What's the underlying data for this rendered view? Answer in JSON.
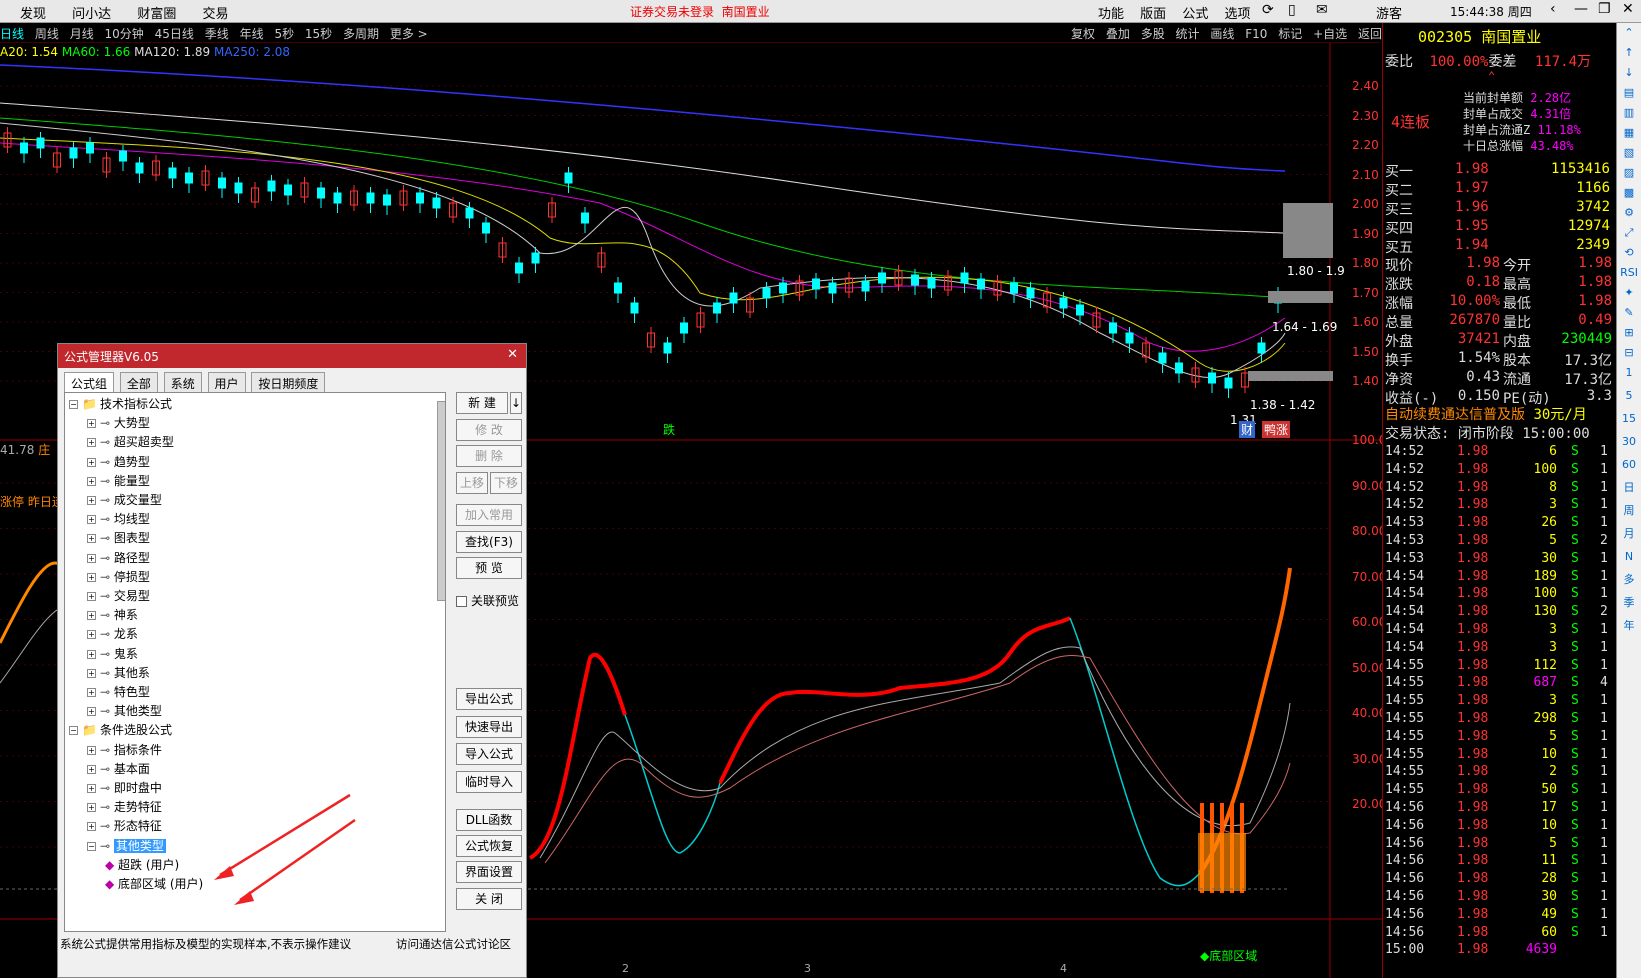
{
  "topbar": {
    "menu": [
      "发现",
      "问小达",
      "财富圈",
      "交易"
    ],
    "notice": "证券交易未登录",
    "stock_notice": "南国置业",
    "right_menu": [
      "功能",
      "版面",
      "公式",
      "选项"
    ],
    "user": "游客",
    "time": "15:44:38 周四"
  },
  "periods": [
    "日线",
    "周线",
    "月线",
    "10分钟",
    "45日线",
    "季线",
    "年线",
    "5秒",
    "15秒",
    "多周期",
    "更多 >"
  ],
  "right_tools": [
    "复权",
    "叠加",
    "多股",
    "统计",
    "画线",
    "F10",
    "标记",
    "+自选",
    "返回"
  ],
  "ma": {
    "ma20": "A20: 1.54",
    "ma60": "MA60: 1.66",
    "ma120": "MA120: 1.89",
    "ma250": "MA250: 2.08"
  },
  "price_axis": [
    "2.40",
    "2.30",
    "2.20",
    "2.10",
    "2.00",
    "1.90",
    "1.80",
    "1.70",
    "1.60",
    "1.50",
    "1.40"
  ],
  "osc_axis": [
    "100.0",
    "90.00",
    "80.00",
    "70.00",
    "60.00",
    "50.00",
    "40.00",
    "30.00",
    "20.00"
  ],
  "chart_labels": {
    "range1": "1.80 - 1.9",
    "range2": "1.64 - 1.69",
    "range3": "1.38 - 1.42",
    "low": "1.31",
    "fall": "跌",
    "cai": "财",
    "lianzhang": "鸭涨",
    "bottom_area": "◆底部区域",
    "left_val": "41.78",
    "left_txt": "庄",
    "left_txt2": "涨停 昨日连",
    "x_ticks": [
      "2",
      "3",
      "4"
    ]
  },
  "quote": {
    "code": "002305",
    "name": "南国置业",
    "weibi_label": "委比",
    "weibi": "100.00%",
    "weicha_label": "委差",
    "weicha": "117.4万",
    "limit_label": "4连板",
    "seal": [
      [
        "当前封单额",
        "2.28亿"
      ],
      [
        "封单占成交",
        "4.31倍"
      ],
      [
        "封单占流通Z",
        "11.18%"
      ],
      [
        "十日总涨幅",
        "43.48%"
      ]
    ],
    "bids": [
      [
        "买一",
        "1.98",
        "1153416"
      ],
      [
        "买二",
        "1.97",
        "1166"
      ],
      [
        "买三",
        "1.96",
        "3742"
      ],
      [
        "买四",
        "1.95",
        "12974"
      ],
      [
        "买五",
        "1.94",
        "2349"
      ]
    ],
    "stats": [
      [
        "现价",
        "1.98",
        "今开",
        "1.98"
      ],
      [
        "涨跌",
        "0.18",
        "最高",
        "1.98"
      ],
      [
        "涨幅",
        "10.00%",
        "最低",
        "1.98"
      ],
      [
        "总量",
        "267870",
        "量比",
        "0.49"
      ],
      [
        "外盘",
        "37421",
        "内盘",
        "230449"
      ],
      [
        "换手",
        "1.54%",
        "股本",
        "17.3亿"
      ],
      [
        "净资",
        "0.43",
        "流通",
        "17.3亿"
      ],
      [
        "收益(-)",
        "0.150",
        "PE(动)",
        "3.3"
      ]
    ],
    "ad": "自动续费通达信普及版",
    "ad_price": "30元/月",
    "trade_state": "交易状态: 闭市阶段 15:00:00",
    "ticks": [
      [
        "14:52",
        "1.98",
        "6",
        "S",
        "1"
      ],
      [
        "14:52",
        "1.98",
        "100",
        "S",
        "1"
      ],
      [
        "14:52",
        "1.98",
        "8",
        "S",
        "1"
      ],
      [
        "14:52",
        "1.98",
        "3",
        "S",
        "1"
      ],
      [
        "14:53",
        "1.98",
        "26",
        "S",
        "1"
      ],
      [
        "14:53",
        "1.98",
        "5",
        "S",
        "2"
      ],
      [
        "14:53",
        "1.98",
        "30",
        "S",
        "1"
      ],
      [
        "14:54",
        "1.98",
        "189",
        "S",
        "1"
      ],
      [
        "14:54",
        "1.98",
        "100",
        "S",
        "1"
      ],
      [
        "14:54",
        "1.98",
        "130",
        "S",
        "2"
      ],
      [
        "14:54",
        "1.98",
        "3",
        "S",
        "1"
      ],
      [
        "14:54",
        "1.98",
        "3",
        "S",
        "1"
      ],
      [
        "14:55",
        "1.98",
        "112",
        "S",
        "1"
      ],
      [
        "14:55",
        "1.98",
        "687",
        "S",
        "4"
      ],
      [
        "14:55",
        "1.98",
        "3",
        "S",
        "1"
      ],
      [
        "14:55",
        "1.98",
        "298",
        "S",
        "1"
      ],
      [
        "14:55",
        "1.98",
        "5",
        "S",
        "1"
      ],
      [
        "14:55",
        "1.98",
        "10",
        "S",
        "1"
      ],
      [
        "14:55",
        "1.98",
        "2",
        "S",
        "1"
      ],
      [
        "14:55",
        "1.98",
        "50",
        "S",
        "1"
      ],
      [
        "14:56",
        "1.98",
        "17",
        "S",
        "1"
      ],
      [
        "14:56",
        "1.98",
        "10",
        "S",
        "1"
      ],
      [
        "14:56",
        "1.98",
        "5",
        "S",
        "1"
      ],
      [
        "14:56",
        "1.98",
        "11",
        "S",
        "1"
      ],
      [
        "14:56",
        "1.98",
        "28",
        "S",
        "1"
      ],
      [
        "14:56",
        "1.98",
        "30",
        "S",
        "1"
      ],
      [
        "14:56",
        "1.98",
        "49",
        "S",
        "1"
      ],
      [
        "14:56",
        "1.98",
        "60",
        "S",
        "1"
      ],
      [
        "15:00",
        "1.98",
        "4639",
        "",
        ""
      ]
    ]
  },
  "side_icons": [
    "1",
    "5",
    "15",
    "30",
    "60",
    "日",
    "周",
    "月",
    "N",
    "多",
    "季",
    "年"
  ],
  "dialog": {
    "title": "公式管理器V6.05",
    "tabs": [
      "公式组",
      "全部",
      "系统",
      "用户",
      "按日期频度"
    ],
    "tree": [
      {
        "label": "技术指标公式",
        "level": 0,
        "type": "folder"
      },
      {
        "label": "大势型",
        "level": 1
      },
      {
        "label": "超买超卖型",
        "level": 1
      },
      {
        "label": "趋势型",
        "level": 1
      },
      {
        "label": "能量型",
        "level": 1
      },
      {
        "label": "成交量型",
        "level": 1
      },
      {
        "label": "均线型",
        "level": 1
      },
      {
        "label": "图表型",
        "level": 1
      },
      {
        "label": "路径型",
        "level": 1
      },
      {
        "label": "停损型",
        "level": 1
      },
      {
        "label": "交易型",
        "level": 1
      },
      {
        "label": "神系",
        "level": 1
      },
      {
        "label": "龙系",
        "level": 1
      },
      {
        "label": "鬼系",
        "level": 1
      },
      {
        "label": "其他系",
        "level": 1
      },
      {
        "label": "特色型",
        "level": 1
      },
      {
        "label": "其他类型",
        "level": 1
      },
      {
        "label": "条件选股公式",
        "level": 0,
        "type": "folder"
      },
      {
        "label": "指标条件",
        "level": 1
      },
      {
        "label": "基本面",
        "level": 1
      },
      {
        "label": "即时盘中",
        "level": 1
      },
      {
        "label": "走势特征",
        "level": 1
      },
      {
        "label": "形态特征",
        "level": 1
      },
      {
        "label": "其他类型",
        "level": 1,
        "selected": true
      },
      {
        "label": "超跌 (用户)",
        "level": 2
      },
      {
        "label": "底部区域 (用户)",
        "level": 2
      }
    ],
    "buttons": [
      {
        "label": "新 建",
        "enabled": true
      },
      {
        "label": "修 改",
        "enabled": false
      },
      {
        "label": "删 除",
        "enabled": false
      },
      {
        "label": "上移",
        "enabled": false
      },
      {
        "label": "下移",
        "enabled": false
      },
      {
        "label": "加入常用",
        "enabled": false
      },
      {
        "label": "查找(F3)",
        "enabled": true
      },
      {
        "label": "预 览",
        "enabled": true
      },
      {
        "label": "导出公式",
        "enabled": true
      },
      {
        "label": "快速导出",
        "enabled": true
      },
      {
        "label": "导入公式",
        "enabled": true
      },
      {
        "label": "临时导入",
        "enabled": true
      },
      {
        "label": "DLL函数",
        "enabled": true
      },
      {
        "label": "公式恢复",
        "enabled": true
      },
      {
        "label": "界面设置",
        "enabled": true
      },
      {
        "label": "关 闭",
        "enabled": true
      }
    ],
    "checkbox": "关联预览",
    "footer_left": "系统公式提供常用指标及模型的实现样本,不表示操作建议",
    "footer_right": "访问通达信公式讨论区"
  }
}
